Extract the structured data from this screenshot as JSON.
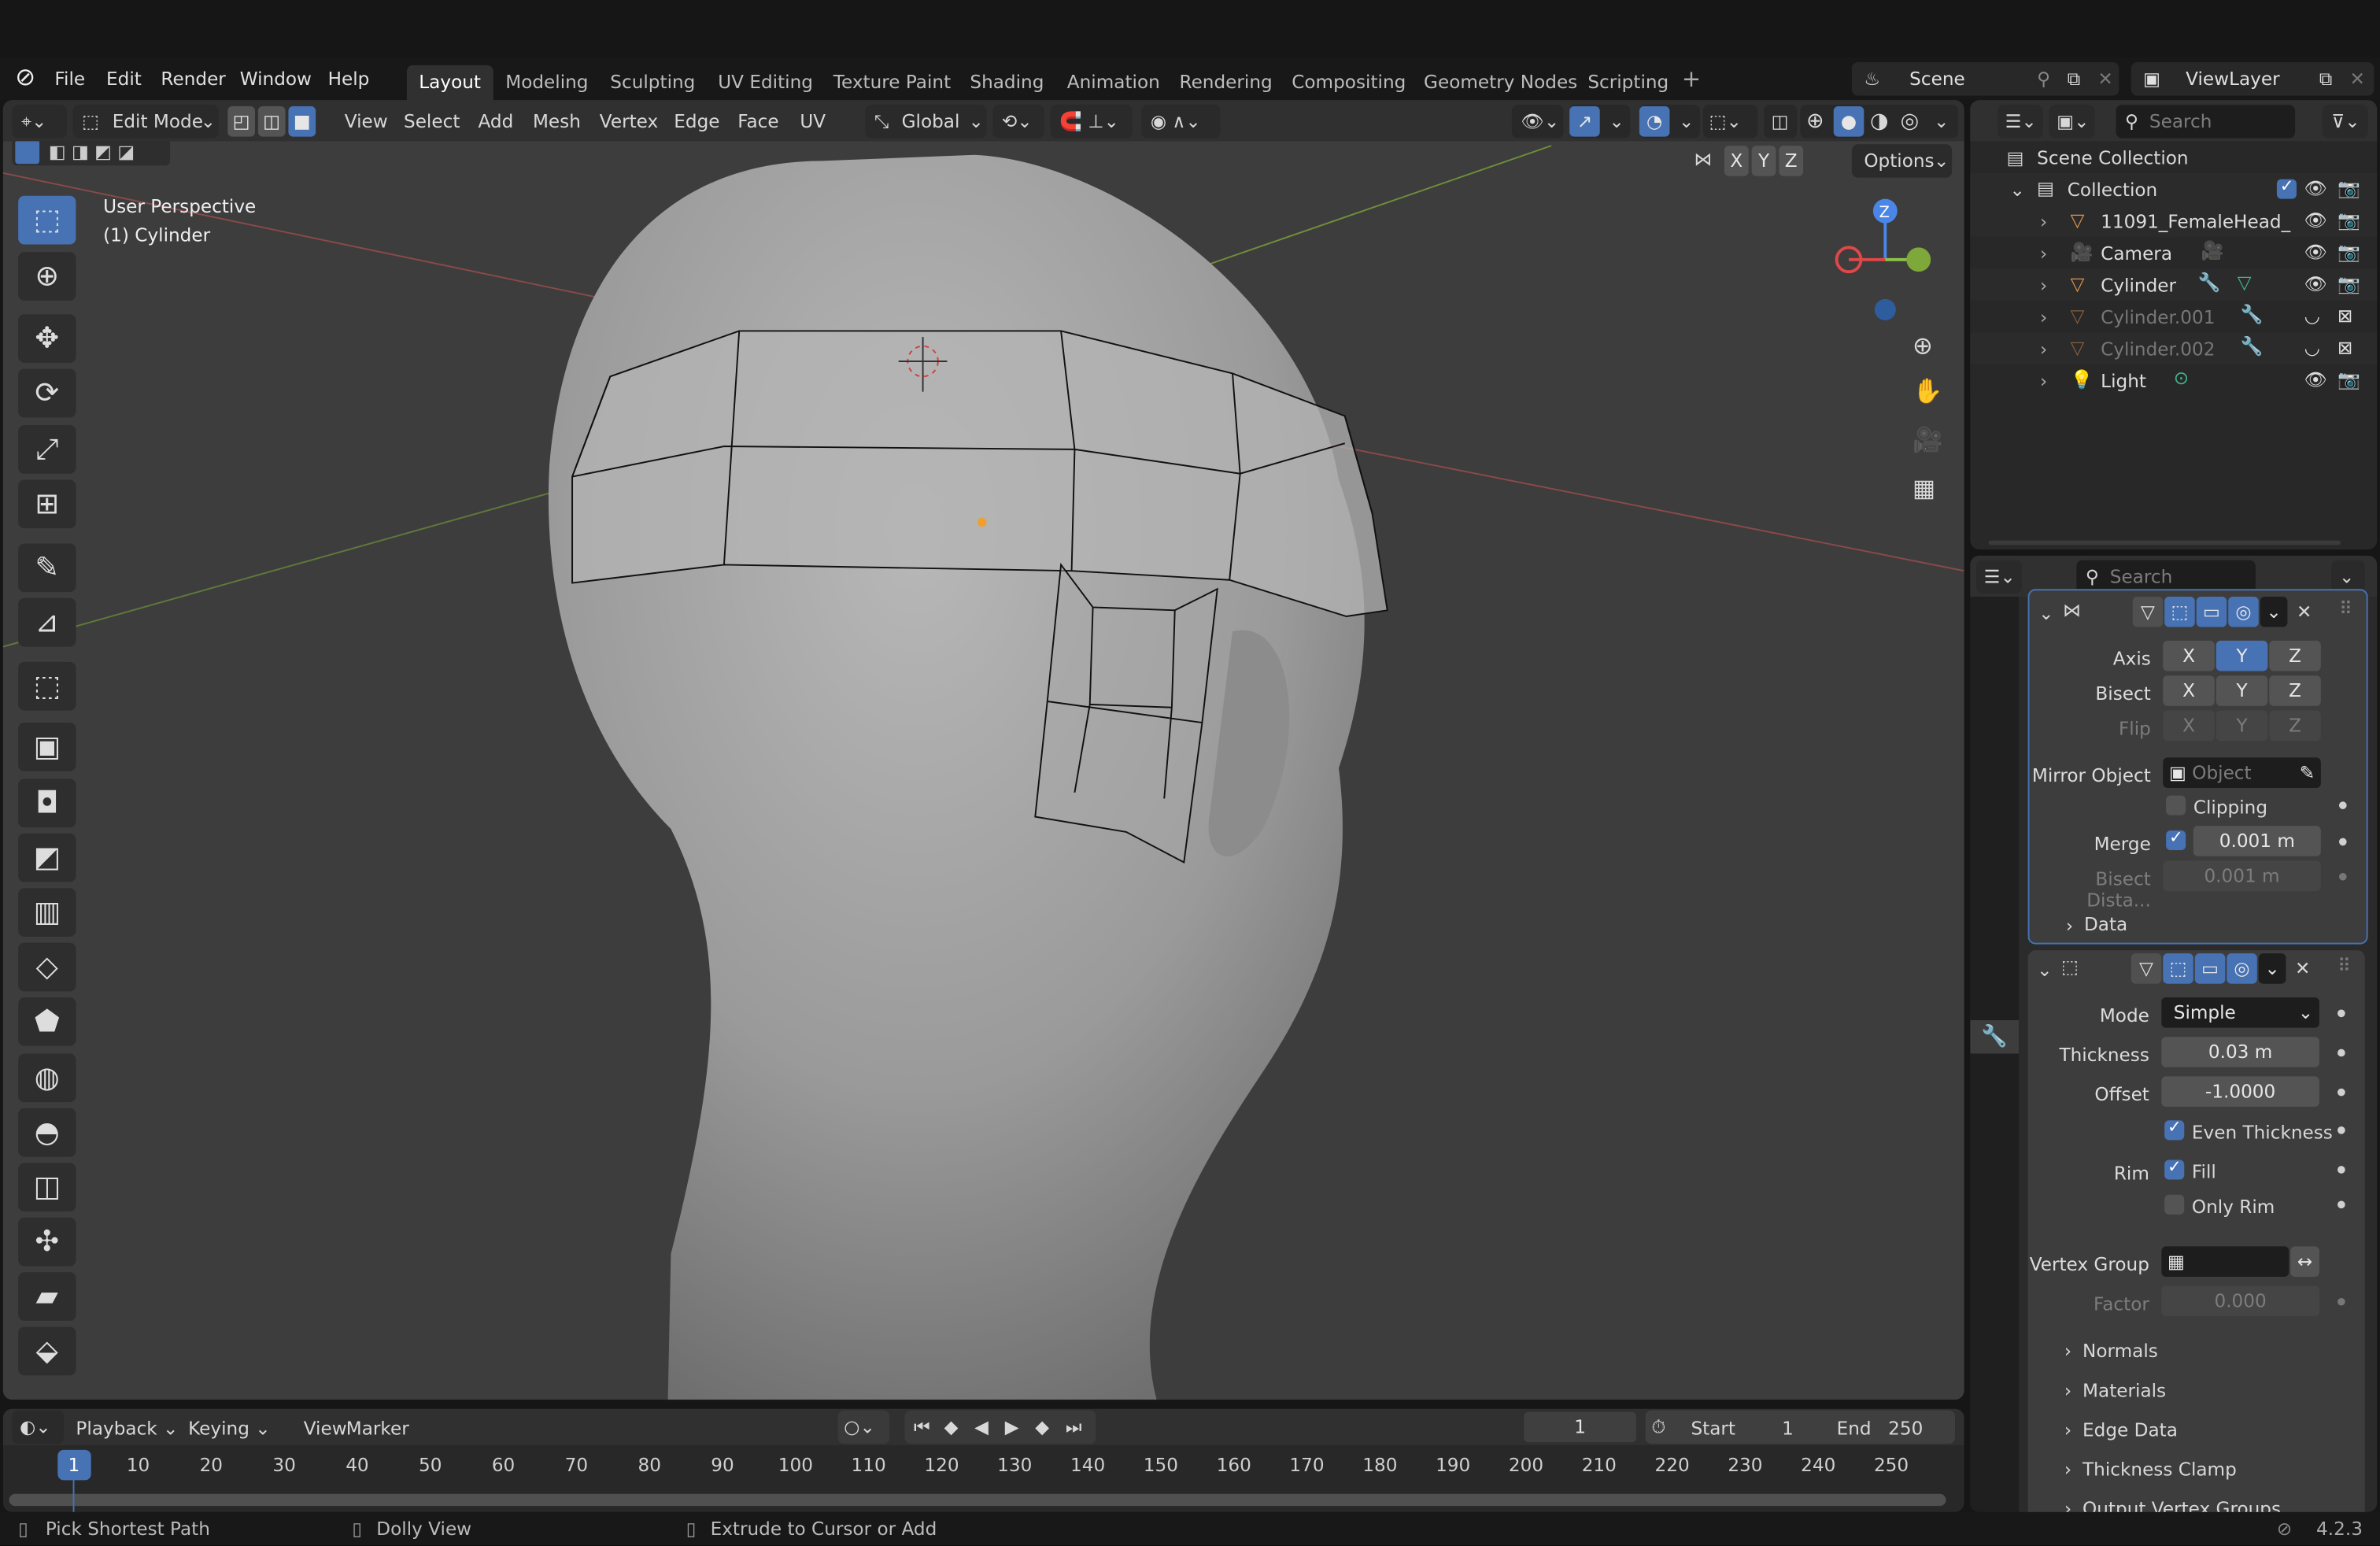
{
  "menubar": {
    "items": [
      "File",
      "Edit",
      "Render",
      "Window",
      "Help"
    ],
    "workspaces": [
      "Layout",
      "Modeling",
      "Sculpting",
      "UV Editing",
      "Texture Paint",
      "Shading",
      "Animation",
      "Rendering",
      "Compositing",
      "Geometry Nodes",
      "Scripting"
    ],
    "active_workspace": "Layout",
    "scene": "Scene",
    "view_layer": "ViewLayer"
  },
  "viewport": {
    "mode": "Edit Mode",
    "menus": [
      "View",
      "Select",
      "Add",
      "Mesh",
      "Vertex",
      "Edge",
      "Face",
      "UV"
    ],
    "transform_orientation": "Global",
    "options_label": "Options",
    "axes": [
      "X",
      "Y",
      "Z"
    ],
    "overlay_line1": "User Perspective",
    "overlay_line2": "(1) Cylinder",
    "gizmo_z": "Z"
  },
  "outliner": {
    "search_placeholder": "Search",
    "scene_collection": "Scene Collection",
    "collection": "Collection",
    "items": [
      {
        "name": "11091_FemaleHead_",
        "type": "mesh",
        "visible": true
      },
      {
        "name": "Camera",
        "type": "camera",
        "visible": true
      },
      {
        "name": "Cylinder",
        "type": "mesh",
        "visible": true,
        "active": true
      },
      {
        "name": "Cylinder.001",
        "type": "mesh",
        "visible": false
      },
      {
        "name": "Cylinder.002",
        "type": "mesh",
        "visible": false
      },
      {
        "name": "Light",
        "type": "light",
        "visible": true
      }
    ]
  },
  "properties": {
    "search_placeholder": "Search",
    "mirror": {
      "axis_label": "Axis",
      "bisect_label": "Bisect",
      "flip_label": "Flip",
      "axis_selected": "Y",
      "mirror_object_label": "Mirror Object",
      "mirror_object_placeholder": "Object",
      "clipping_label": "Clipping",
      "clipping": false,
      "merge_label": "Merge",
      "merge": true,
      "merge_value": "0.001 m",
      "bisect_distance_label": "Bisect Dista...",
      "bisect_distance_value": "0.001 m",
      "data_label": "Data"
    },
    "solidify": {
      "mode_label": "Mode",
      "mode_value": "Simple",
      "thickness_label": "Thickness",
      "thickness_value": "0.03 m",
      "offset_label": "Offset",
      "offset_value": "-1.0000",
      "even_thickness_label": "Even Thickness",
      "even_thickness": true,
      "rim_label": "Rim",
      "fill_label": "Fill",
      "fill": true,
      "only_rim_label": "Only Rim",
      "only_rim": false,
      "vertex_group_label": "Vertex Group",
      "factor_label": "Factor",
      "factor_value": "0.000",
      "subpanels": [
        "Normals",
        "Materials",
        "Edge Data",
        "Thickness Clamp",
        "Output Vertex Groups"
      ]
    }
  },
  "timeline": {
    "menus": [
      "Playback",
      "Keying",
      "View",
      "Marker"
    ],
    "current_frame": "1",
    "start_label": "Start",
    "start": "1",
    "end_label": "End",
    "end": "250",
    "ticks": [
      "1",
      "10",
      "20",
      "30",
      "40",
      "50",
      "60",
      "70",
      "80",
      "90",
      "100",
      "110",
      "120",
      "130",
      "140",
      "150",
      "160",
      "170",
      "180",
      "190",
      "200",
      "210",
      "220",
      "230",
      "240",
      "250"
    ]
  },
  "statusbar": {
    "hints": [
      "Pick Shortest Path",
      "Dolly View",
      "Extrude to Cursor or Add"
    ],
    "version": "4.2.3"
  },
  "colors": {
    "accent": "#4772b3",
    "object_orange": "#e0954a",
    "data_green": "#3fb58b",
    "modifier_blue": "#6b8fd6"
  }
}
